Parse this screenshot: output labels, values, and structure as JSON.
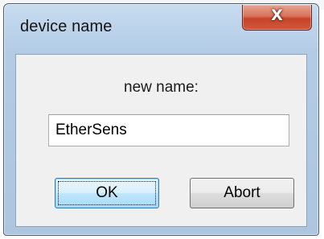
{
  "dialog": {
    "title": "device name",
    "close_glyph": "X",
    "prompt": "new name:",
    "name_value": "EtherSens",
    "ok_label": "OK",
    "abort_label": "Abort"
  },
  "icons": {
    "close": "close-icon"
  },
  "colors": {
    "frame": "#b3cce6",
    "close_button": "#c7432a",
    "client": "#f0f0f0",
    "ok_button_border": "#3c7fb1"
  }
}
